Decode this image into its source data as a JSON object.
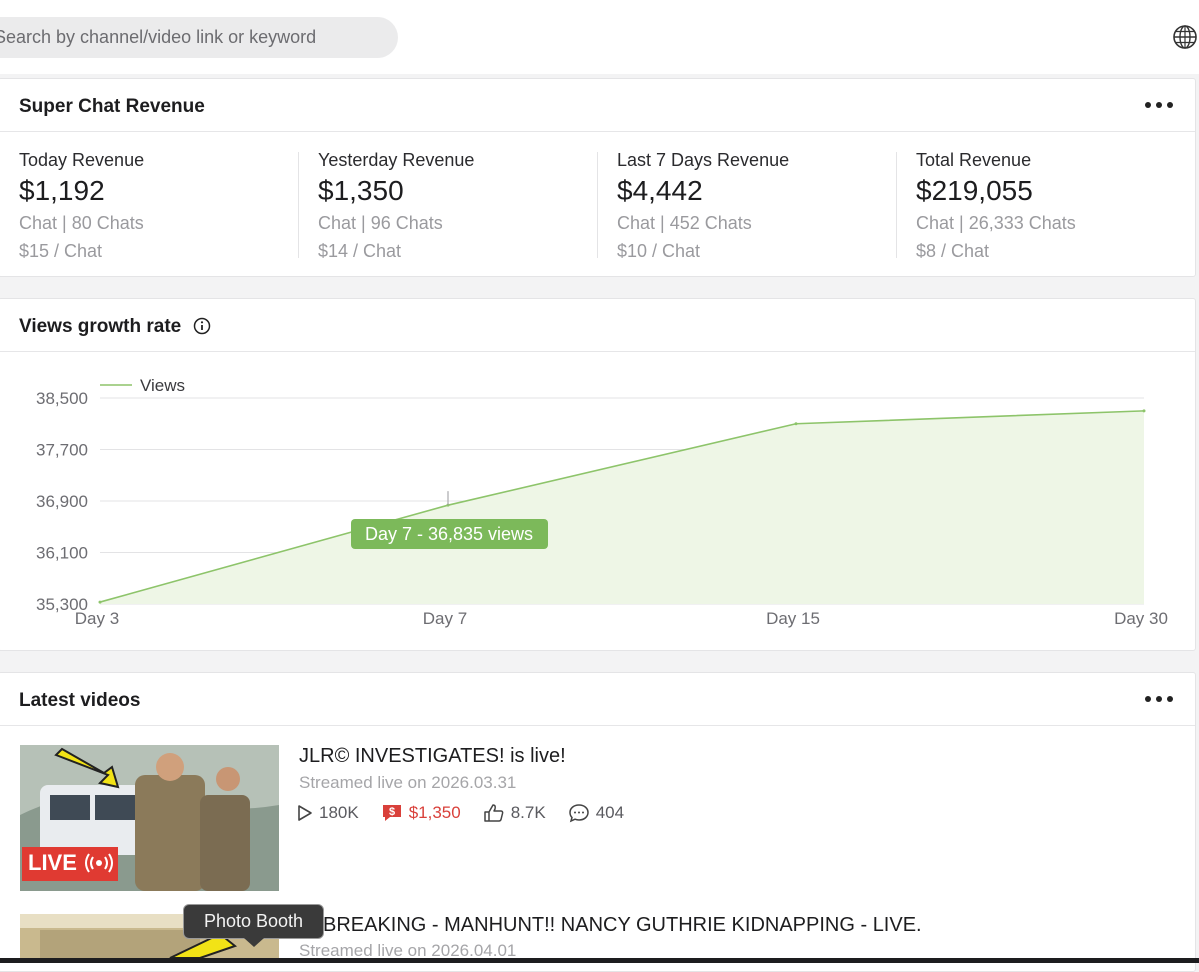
{
  "search": {
    "placeholder": "Search by channel/video link or keyword"
  },
  "revenue": {
    "title": "Super Chat Revenue",
    "stats": [
      {
        "label": "Today Revenue",
        "value": "$1,192",
        "chats": "Chat | 80 Chats",
        "per_chat": "$15 / Chat"
      },
      {
        "label": "Yesterday Revenue",
        "value": "$1,350",
        "chats": "Chat | 96 Chats",
        "per_chat": "$14 / Chat"
      },
      {
        "label": "Last 7 Days Revenue",
        "value": "$4,442",
        "chats": "Chat | 452 Chats",
        "per_chat": "$10 / Chat"
      },
      {
        "label": "Total Revenue",
        "value": "$219,055",
        "chats": "Chat | 26,333 Chats",
        "per_chat": "$8 / Chat"
      }
    ]
  },
  "growth": {
    "title": "Views growth rate",
    "tooltip": "Day 7 - 36,835 views"
  },
  "chart_data": {
    "type": "area",
    "title": "",
    "xlabel": "",
    "ylabel": "",
    "categories": [
      "Day 3",
      "Day 7",
      "Day 15",
      "Day 30"
    ],
    "series": [
      {
        "name": "Views",
        "values": [
          35330,
          36835,
          38100,
          38300
        ]
      }
    ],
    "ylim": [
      35300,
      38500
    ],
    "yticks": [
      "38,500",
      "37,700",
      "36,900",
      "36,100",
      "35,300"
    ],
    "grid": true,
    "legend": "top-left",
    "colors": {
      "line": "#8dc46a",
      "fill": "#eef6e6",
      "tooltip_bg": "#7cb95a"
    }
  },
  "latest": {
    "title": "Latest videos",
    "videos": [
      {
        "title": "JLR© INVESTIGATES! is live!",
        "date": "Streamed live on 2026.03.31",
        "views": "180K",
        "revenue": "$1,350",
        "likes": "8.7K",
        "comments": "404",
        "badge": "LIVE"
      },
      {
        "title": "BREAKING - MANHUNT!! NANCY GUTHRIE KIDNAPPING - LIVE.",
        "date": "Streamed live on 2026.04.01"
      }
    ]
  },
  "tooltip_app": "Photo Booth",
  "colors": {
    "accent": "#8dc46a",
    "revenue_red": "#d9403a"
  }
}
